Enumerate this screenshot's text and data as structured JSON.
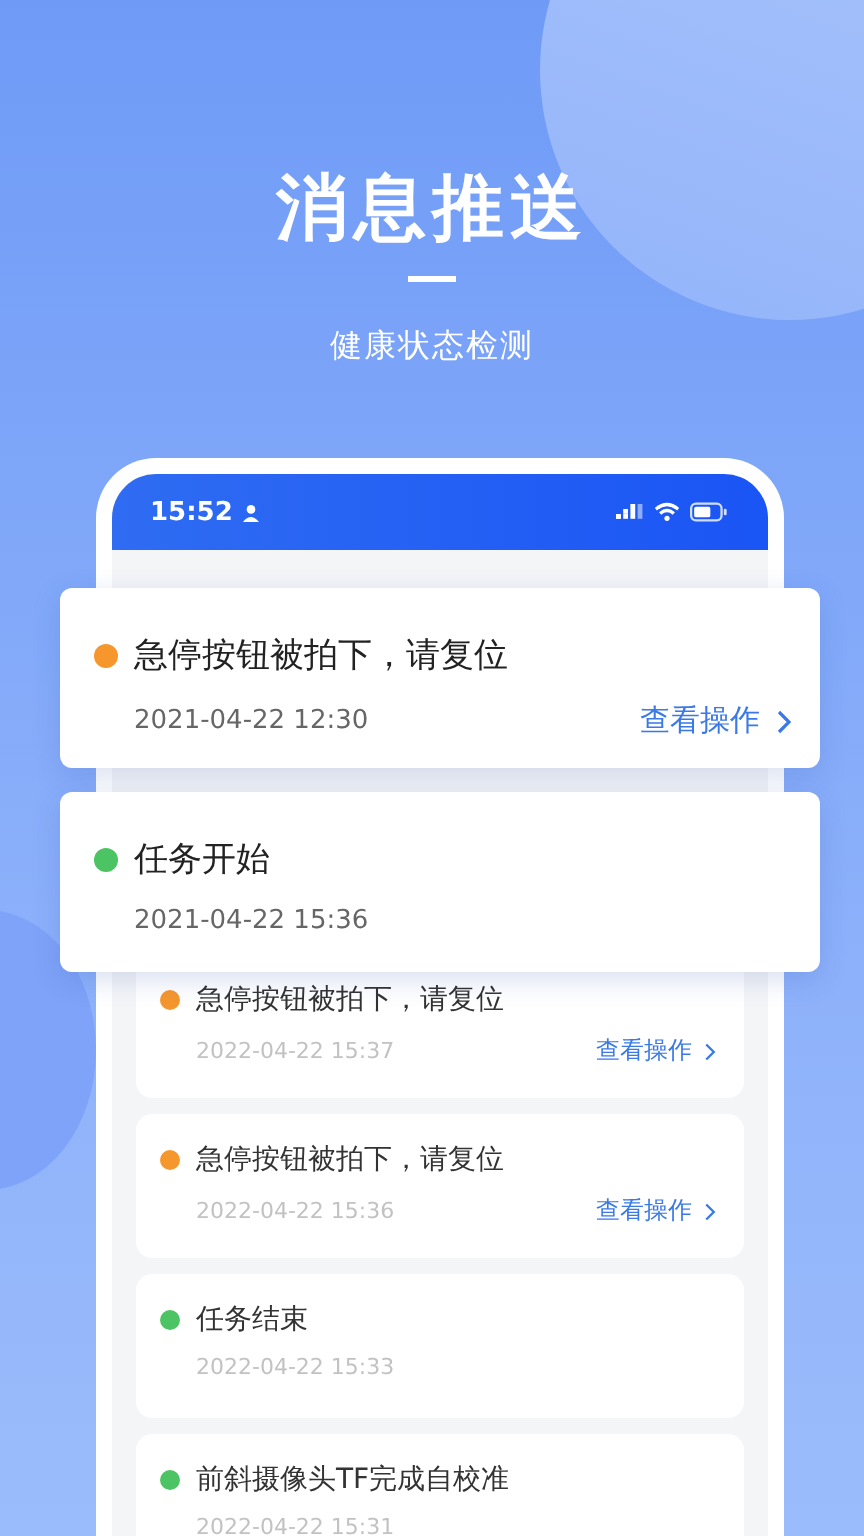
{
  "headline": "消息推送",
  "subtitle": "健康状态检测",
  "status_bar": {
    "time": "15:52"
  },
  "popups": [
    {
      "title": "急停按钮被拍下，请复位",
      "color": "#f5972d",
      "time": "2021-04-22  12:30",
      "action": "查看操作"
    },
    {
      "title": "任务开始",
      "color": "#4cc463",
      "time": "2021-04-22  15:36"
    }
  ],
  "messages": [
    {
      "title": "急停按钮被拍下，请复位",
      "color": "#f5972d",
      "time": "2022-04-22 15:37",
      "action": "查看操作"
    },
    {
      "title": "急停按钮被拍下，请复位",
      "color": "#f5972d",
      "time": "2022-04-22 15:36",
      "action": "查看操作"
    },
    {
      "title": "任务结束",
      "color": "#4cc463",
      "time": "2022-04-22 15:33"
    },
    {
      "title": "前斜摄像头TF完成自校准",
      "color": "#4cc463",
      "time": "2022-04-22 15:31"
    }
  ]
}
